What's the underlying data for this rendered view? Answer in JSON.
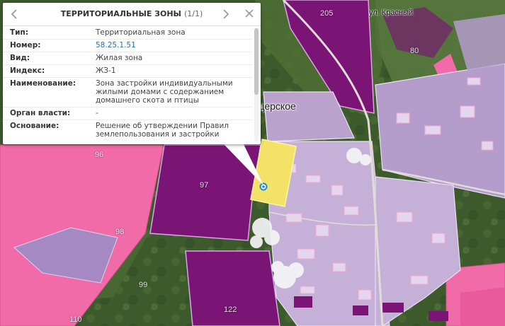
{
  "popup": {
    "title": "ТЕРРИТОРИАЛЬНЫЕ ЗОНЫ",
    "counter": "(1/1)",
    "prev_icon": "chevron-left-icon",
    "next_icon": "chevron-right-icon",
    "close_icon": "close-icon",
    "rows": [
      {
        "key": "Тип:",
        "value": "Территориальная зона"
      },
      {
        "key": "Номер:",
        "value": "58.25.1.51"
      },
      {
        "key": "Вид:",
        "value": "Жилая зона"
      },
      {
        "key": "Индекс:",
        "value": "ЖЗ-1"
      },
      {
        "key": "Наименование:",
        "value": "Зона застройки индивидуальными жилыми домами с содержанием домашнего скота и птицы"
      },
      {
        "key": "Орган власти:",
        "value": "-"
      },
      {
        "key": "Основание:",
        "value": "Решение об утверждении Правил землепользования и застройки"
      }
    ]
  },
  "map": {
    "place_label": "…щерское",
    "street_label": "ул. Красный",
    "parcel_labels": [
      "205",
      "80",
      "96",
      "97",
      "98",
      "99",
      "110",
      "122"
    ],
    "colors": {
      "pink_zone": "#f06ba8",
      "purple_zone": "#7a1475",
      "lavender_zone": "#c5b0d8",
      "selected_zone": "#f2e268",
      "marker": "#1e88e5"
    }
  }
}
